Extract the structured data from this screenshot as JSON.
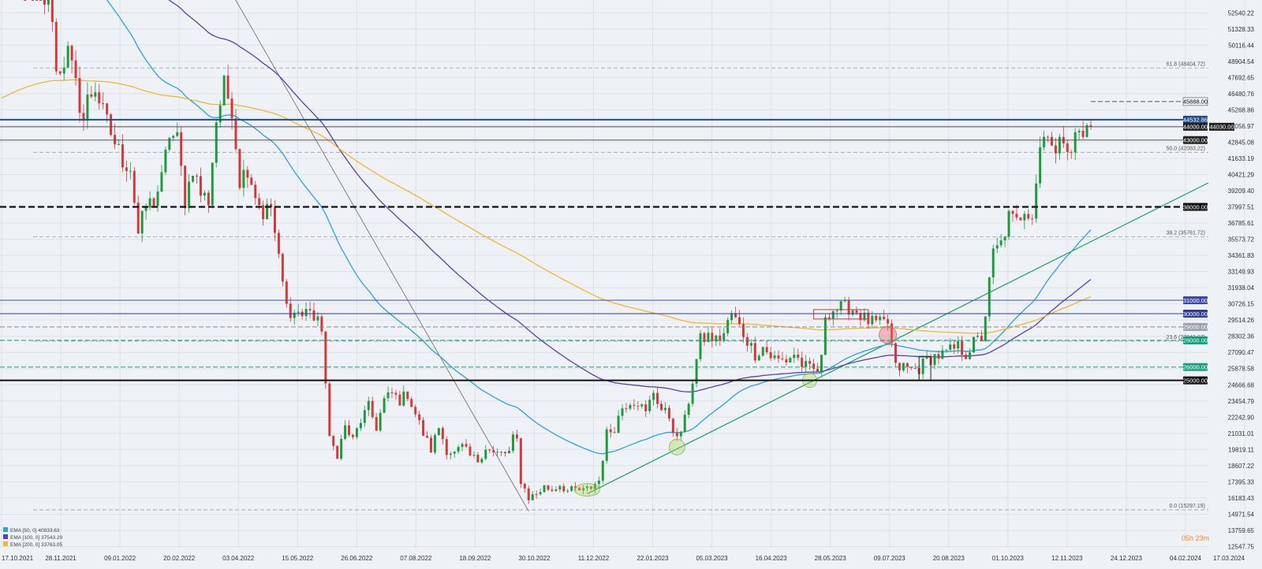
{
  "chart_data": {
    "type": "candlestick",
    "instrument_hint": "BTC-like price chart (weekly/daily candles)",
    "x_ticks": [
      "17.10.2021",
      "28.11.2021",
      "09.01.2022",
      "20.02.2022",
      "03.04.2022",
      "15.05.2022",
      "26.06.2022",
      "07.08.2022",
      "18.09.2022",
      "30.10.2022",
      "11.12.2022",
      "22.01.2023",
      "05.03.2023",
      "16.04.2023",
      "28.05.2023",
      "09.07.2023",
      "20.08.2023",
      "01.10.2023",
      "12.11.2023",
      "24.12.2023",
      "04.02.2024",
      "17.03.2024"
    ],
    "y_ticks": [
      52540.22,
      51328.33,
      50116.44,
      48904.54,
      47692.65,
      46480.76,
      45268.86,
      44056.97,
      42845.08,
      41633.19,
      40421.29,
      39209.4,
      37997.51,
      36785.61,
      35573.72,
      34361.83,
      33149.93,
      31938.04,
      30726.15,
      29514.26,
      28302.36,
      27090.47,
      25878.58,
      24666.68,
      23454.79,
      22242.9,
      21031.01,
      19819.11,
      18607.22,
      17395.33,
      16183.43,
      14971.54,
      13759.65,
      12547.75
    ],
    "ylim": [
      12400,
      53500
    ],
    "current_price_tag": "44030.00",
    "countdown": "05h 23m",
    "horizontal_levels": [
      {
        "label": "45888.00",
        "value": 45888,
        "style": "dash",
        "color": "#555555"
      },
      {
        "label": "44532.86",
        "value": 44532.86,
        "style": "solid",
        "color": "#1f4e8c",
        "tag_bg": "#1f4e8c",
        "tag_fg": "#ffffff"
      },
      {
        "label": "44000.00",
        "value": 44000,
        "style": "solid",
        "color": "#555555",
        "tag_bg": "#222222",
        "tag_fg": "#ffffff"
      },
      {
        "label": "43000.00",
        "value": 43000,
        "style": "solid",
        "color": "#555555",
        "tag_bg": "#222222",
        "tag_fg": "#ffffff"
      },
      {
        "label": "38000.00",
        "value": 38000,
        "style": "dash-bold",
        "color": "#111111",
        "tag_bg": "#111111",
        "tag_fg": "#ffffff"
      },
      {
        "label": "31000.00",
        "value": 31000,
        "style": "solid",
        "color": "#4b4fa8",
        "tag_bg": "#3b4aa8",
        "tag_fg": "#ffffff"
      },
      {
        "label": "30000.00",
        "value": 30000,
        "style": "solid",
        "color": "#2c3a9a",
        "tag_bg": "#2c3a9a",
        "tag_fg": "#ffffff"
      },
      {
        "label": "29000.00",
        "value": 29000,
        "style": "dash",
        "color": "#888888",
        "tag_bg": "#9aa0a8",
        "tag_fg": "#ffffff"
      },
      {
        "label": "28000.00",
        "value": 28000,
        "style": "dash",
        "color": "#0a9d78",
        "tag_bg": "#0a9d78",
        "tag_fg": "#ffffff"
      },
      {
        "label": "26000.00",
        "value": 26000,
        "style": "dash",
        "color": "#1aa080",
        "tag_bg": "#1aa080",
        "tag_fg": "#ffffff"
      },
      {
        "label": "25000.00",
        "value": 25000,
        "style": "solid-bold",
        "color": "#111111",
        "tag_bg": "#111111",
        "tag_fg": "#ffffff"
      }
    ],
    "fib_levels": [
      {
        "label": "61.8 (48404.72)",
        "value": 48404.72
      },
      {
        "label": "50.0 (42083.22)",
        "value": 42083.22
      },
      {
        "label": "38.2 (35761.72)",
        "value": 35761.72
      },
      {
        "label": "23.6 (27943.07)",
        "value": 27943.07
      },
      {
        "label": "0.0 (15297.19)",
        "value": 15297.19
      }
    ],
    "legend": [
      {
        "label": "EMA [50, 0]",
        "value": "40833.63",
        "color": "#29a3dd"
      },
      {
        "label": "EMA [100, 0]",
        "value": "37543.29",
        "color": "#5b3fb0"
      },
      {
        "label": "EMA [200, 0]",
        "value": "33763.05",
        "color": "#f0b731"
      }
    ],
    "price_path": [
      [
        0,
        61000
      ],
      [
        6,
        58000
      ],
      [
        10,
        54000
      ],
      [
        13,
        52500
      ],
      [
        14,
        48000
      ],
      [
        17,
        49500
      ],
      [
        19,
        47000
      ],
      [
        21,
        44500
      ],
      [
        22,
        46000
      ],
      [
        24,
        47000
      ],
      [
        26,
        45000
      ],
      [
        29,
        42800
      ],
      [
        31,
        41500
      ],
      [
        33,
        41000
      ],
      [
        35,
        36000
      ],
      [
        37,
        38000
      ],
      [
        39,
        38500
      ],
      [
        41,
        40000
      ],
      [
        43,
        43500
      ],
      [
        45,
        43000
      ],
      [
        47,
        38500
      ],
      [
        49,
        41000
      ],
      [
        51,
        39000
      ],
      [
        53,
        38500
      ],
      [
        55,
        44500
      ],
      [
        57,
        47000
      ],
      [
        59,
        45500
      ],
      [
        61,
        40000
      ],
      [
        63,
        41000
      ],
      [
        65,
        39000
      ],
      [
        67,
        37500
      ],
      [
        69,
        38000
      ],
      [
        71,
        34000
      ],
      [
        73,
        30500
      ],
      [
        75,
        30000
      ],
      [
        76,
        30200
      ],
      [
        77,
        29800
      ],
      [
        79,
        30500
      ],
      [
        80,
        29500
      ],
      [
        82,
        29000
      ],
      [
        84,
        20500
      ],
      [
        86,
        19500
      ],
      [
        88,
        21500
      ],
      [
        90,
        20500
      ],
      [
        92,
        22000
      ],
      [
        94,
        23000
      ],
      [
        96,
        21500
      ],
      [
        98,
        23500
      ],
      [
        100,
        24000
      ],
      [
        102,
        23500
      ],
      [
        104,
        24000
      ],
      [
        106,
        22500
      ],
      [
        108,
        21000
      ],
      [
        110,
        19800
      ],
      [
        112,
        21500
      ],
      [
        114,
        19800
      ],
      [
        116,
        19500
      ],
      [
        118,
        20000
      ],
      [
        120,
        19300
      ],
      [
        122,
        19000
      ],
      [
        124,
        20000
      ],
      [
        126,
        19500
      ],
      [
        128,
        19500
      ],
      [
        130,
        19600
      ],
      [
        131,
        20600
      ],
      [
        132,
        20500
      ],
      [
        133,
        17500
      ],
      [
        135,
        16200
      ],
      [
        137,
        16500
      ],
      [
        139,
        17000
      ],
      [
        141,
        16800
      ],
      [
        143,
        17200
      ],
      [
        145,
        16700
      ],
      [
        147,
        16800
      ],
      [
        149,
        16700
      ],
      [
        151,
        17000
      ],
      [
        153,
        17500
      ],
      [
        155,
        21000
      ],
      [
        157,
        21500
      ],
      [
        159,
        23000
      ],
      [
        161,
        23500
      ],
      [
        163,
        23400
      ],
      [
        165,
        22500
      ],
      [
        167,
        24200
      ],
      [
        169,
        22800
      ],
      [
        171,
        22300
      ],
      [
        173,
        20500
      ],
      [
        175,
        22000
      ],
      [
        177,
        25000
      ],
      [
        179,
        28000
      ],
      [
        181,
        28300
      ],
      [
        183,
        28000
      ],
      [
        185,
        28500
      ],
      [
        187,
        30000
      ],
      [
        189,
        29000
      ],
      [
        191,
        28000
      ],
      [
        193,
        27000
      ],
      [
        195,
        27500
      ],
      [
        197,
        26800
      ],
      [
        199,
        26500
      ],
      [
        201,
        26500
      ],
      [
        203,
        27000
      ],
      [
        205,
        26200
      ],
      [
        207,
        25800
      ],
      [
        209,
        25700
      ],
      [
        210,
        26500
      ],
      [
        211,
        30000
      ],
      [
        213,
        30300
      ],
      [
        215,
        30400
      ],
      [
        217,
        30500
      ],
      [
        219,
        30200
      ],
      [
        221,
        29600
      ],
      [
        223,
        29300
      ],
      [
        225,
        29200
      ],
      [
        227,
        29300
      ],
      [
        229,
        25900
      ],
      [
        231,
        26000
      ],
      [
        233,
        25800
      ],
      [
        235,
        25900
      ],
      [
        237,
        26500
      ],
      [
        239,
        26800
      ],
      [
        241,
        26900
      ],
      [
        243,
        27200
      ],
      [
        245,
        27500
      ],
      [
        247,
        27000
      ],
      [
        249,
        27800
      ],
      [
        251,
        28200
      ],
      [
        252,
        30000
      ],
      [
        254,
        34500
      ],
      [
        256,
        35200
      ],
      [
        258,
        37200
      ],
      [
        260,
        36800
      ],
      [
        262,
        38000
      ],
      [
        264,
        37500
      ],
      [
        266,
        42500
      ],
      [
        268,
        44000
      ],
      [
        270,
        41800
      ],
      [
        272,
        43300
      ],
      [
        274,
        42500
      ],
      [
        276,
        43700
      ],
      [
        277,
        43000
      ],
      [
        278,
        44000
      ],
      [
        279,
        44030
      ]
    ]
  }
}
